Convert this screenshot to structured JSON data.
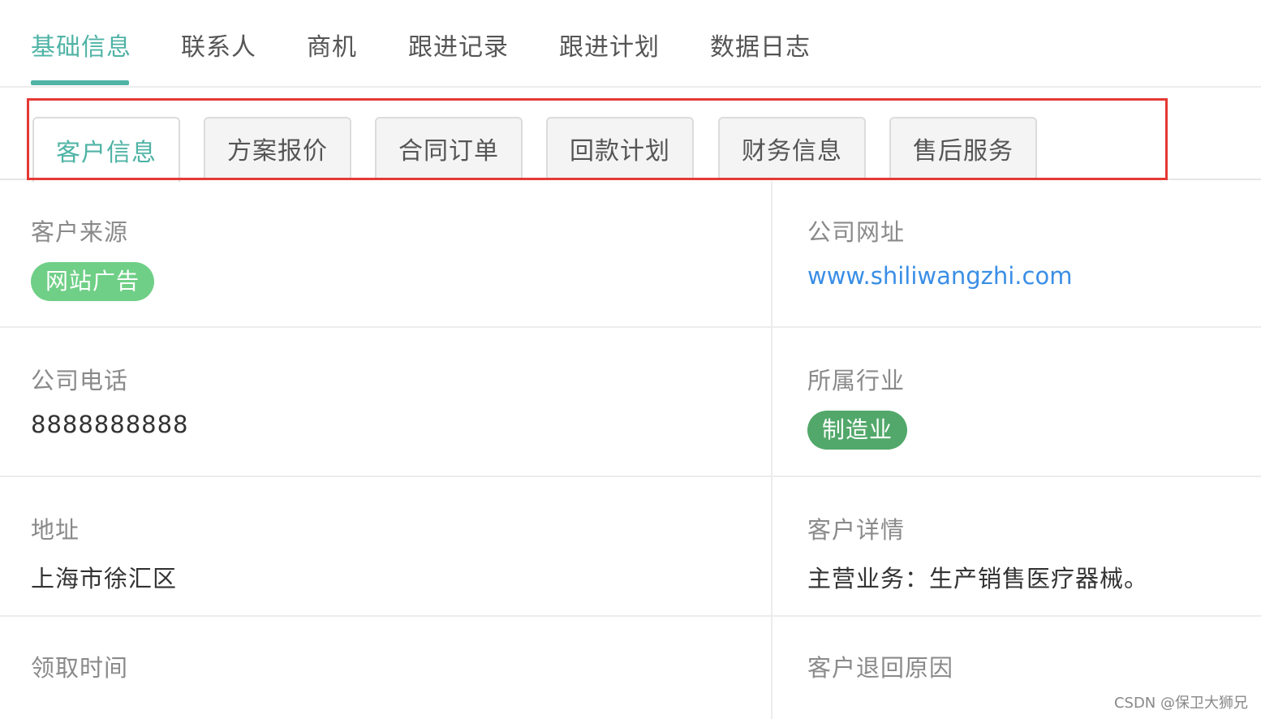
{
  "top_tabs": [
    "基础信息",
    "联系人",
    "商机",
    "跟进记录",
    "跟进计划",
    "数据日志"
  ],
  "sub_tabs": [
    "客户信息",
    "方案报价",
    "合同订单",
    "回款计划",
    "财务信息",
    "售后服务"
  ],
  "fields": {
    "source_label": "客户来源",
    "source_value": "网站广告",
    "website_label": "公司网址",
    "website_value": "www.shiliwangzhi.com",
    "phone_label": "公司电话",
    "phone_value": "8888888888",
    "industry_label": "所属行业",
    "industry_value": "制造业",
    "address_label": "地址",
    "address_value": "上海市徐汇区",
    "detail_label": "客户详情",
    "detail_value": "主营业务：生产销售医疗器械。",
    "claim_time_label": "领取时间",
    "return_reason_label": "客户退回原因"
  },
  "watermark": "CSDN @保卫大狮兄",
  "colors": {
    "accent": "#4fb3a5",
    "highlight_border": "#e53935",
    "link": "#3a8ee6",
    "tag_source": "#6fcf86",
    "tag_industry": "#52a86a"
  }
}
